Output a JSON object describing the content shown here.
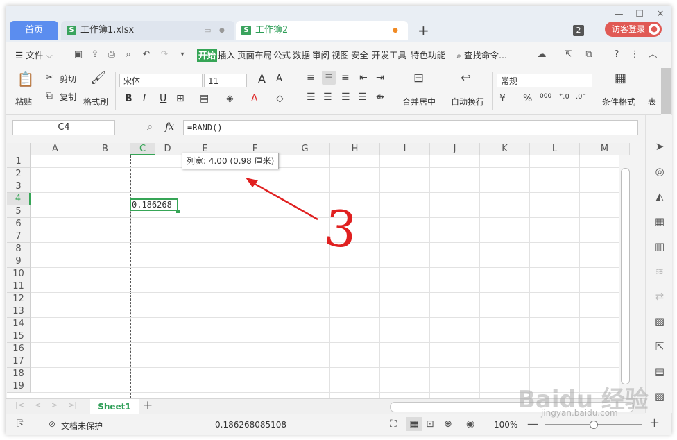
{
  "title_bar": {
    "tabs": [
      {
        "label": "首页"
      },
      {
        "label": "工作簿1.xlsx"
      },
      {
        "label": "工作簿2"
      }
    ],
    "new_tab": "+",
    "tab_count": "2",
    "login_label": "访客登录"
  },
  "menu": {
    "file": "文件",
    "items": [
      "开始",
      "插入",
      "页面布局",
      "公式",
      "数据",
      "审阅",
      "视图",
      "安全",
      "开发工具",
      "特色功能"
    ],
    "search": "查找命令..."
  },
  "ribbon": {
    "paste": "粘贴",
    "cut": "剪切",
    "copy": "复制",
    "format_painter": "格式刷",
    "font_name": "宋体",
    "font_size": "11",
    "font_grow": "A",
    "font_shrink": "A",
    "bold": "B",
    "italic": "I",
    "underline": "U",
    "merge_center": "合并居中",
    "wrap_text": "自动换行",
    "number_format": "常规",
    "percent": "%",
    "thousands": "000",
    "cond_format": "条件格式",
    "table": "表"
  },
  "formula_bar": {
    "name_box": "C4",
    "fx": "fx",
    "formula": "=RAND()"
  },
  "grid": {
    "columns": [
      "A",
      "B",
      "C",
      "D",
      "E",
      "F",
      "G",
      "H",
      "I",
      "J",
      "K",
      "L",
      "M"
    ],
    "rows": [
      "1",
      "2",
      "3",
      "4",
      "5",
      "6",
      "7",
      "8",
      "9",
      "10",
      "11",
      "12",
      "13",
      "14",
      "15",
      "16",
      "17",
      "18",
      "19"
    ],
    "active_cell_value": "0.186268",
    "tooltip": "列宽: 4.00 (0.98 厘米)",
    "annotation": "3"
  },
  "sheets": {
    "active": "Sheet1",
    "add": "+"
  },
  "status_bar": {
    "protection": "文档未保护",
    "cell_value": "0.186268085108",
    "zoom": "100%",
    "watermark_logo": "Baidu 经验",
    "watermark_url": "jingyan.baidu.com"
  },
  "colors": {
    "accent_green": "#36a556",
    "home_tab_blue": "#5b8def",
    "login_red": "#e05a55",
    "annotation_red": "#e02020"
  }
}
